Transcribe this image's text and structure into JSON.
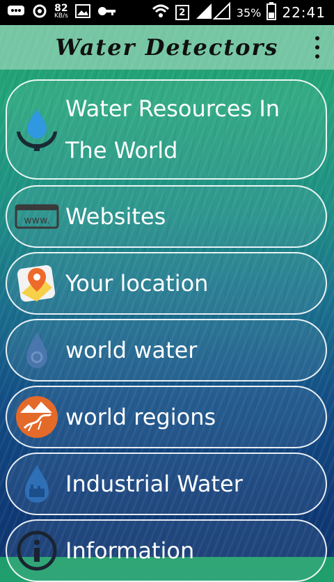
{
  "status_bar": {
    "speed_value": "82",
    "speed_unit": "KB/s",
    "sim": "2",
    "battery": "35%",
    "time": "22:41"
  },
  "app_bar": {
    "title": "Water Detectors"
  },
  "menu": {
    "items": [
      {
        "label": "Water Resources In The World",
        "icon": "water-hands-icon"
      },
      {
        "label": "Websites",
        "icon": "www-icon"
      },
      {
        "label": "Your location",
        "icon": "map-pin-icon"
      },
      {
        "label": "world water",
        "icon": "water-drop-icon"
      },
      {
        "label": "world regions",
        "icon": "regions-icon"
      },
      {
        "label": "Industrial Water",
        "icon": "industrial-drop-icon"
      },
      {
        "label": "Information",
        "icon": "info-icon"
      }
    ]
  }
}
